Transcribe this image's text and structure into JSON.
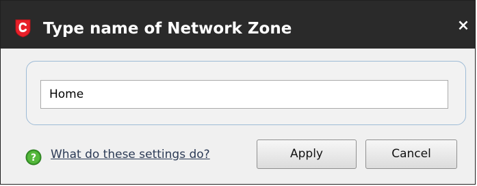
{
  "dialog": {
    "title": "Type name of Network Zone",
    "logo_icon": "comodo-shield-icon",
    "close_icon": "close-icon",
    "close_glyph": "×"
  },
  "form": {
    "name_value": "Home"
  },
  "footer": {
    "help_icon": "question-icon",
    "help_link": "What do these settings do?",
    "apply_label": "Apply",
    "cancel_label": "Cancel"
  },
  "colors": {
    "titlebar": "#2a2a2a",
    "logo_red": "#e8202a",
    "help_green": "#3a9a2a",
    "panel_border": "#9dbbd6"
  }
}
